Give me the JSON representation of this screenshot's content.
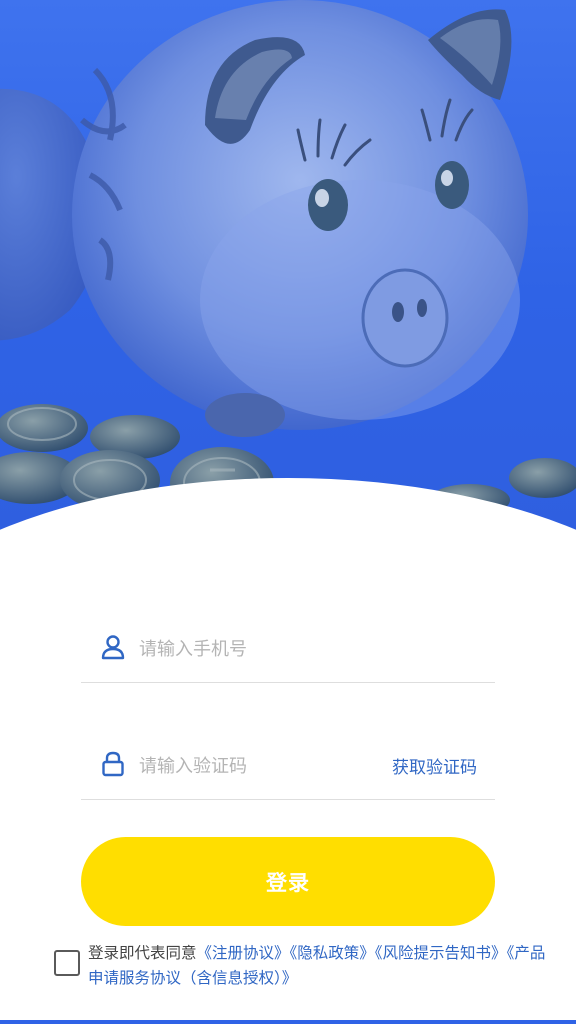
{
  "hero": {
    "image_name": "piggy-bank-coins-banner",
    "tint": "#2f63e6"
  },
  "phone": {
    "icon": "user-icon",
    "placeholder": "请输入手机号",
    "value": ""
  },
  "code": {
    "icon": "lock-icon",
    "placeholder": "请输入验证码",
    "value": "",
    "get_code_label": "获取验证码"
  },
  "login_label": "登录",
  "agreement": {
    "checked": false,
    "prefix": "登录即代表同意",
    "links": [
      "《注册协议》",
      "《隐私政策》",
      "《风险提示告知书》",
      "《产品申请服务协议（含信息授权）》"
    ]
  },
  "colors": {
    "accent": "#3067c4",
    "button": "#ffde00",
    "hero": "#2f63e6"
  }
}
